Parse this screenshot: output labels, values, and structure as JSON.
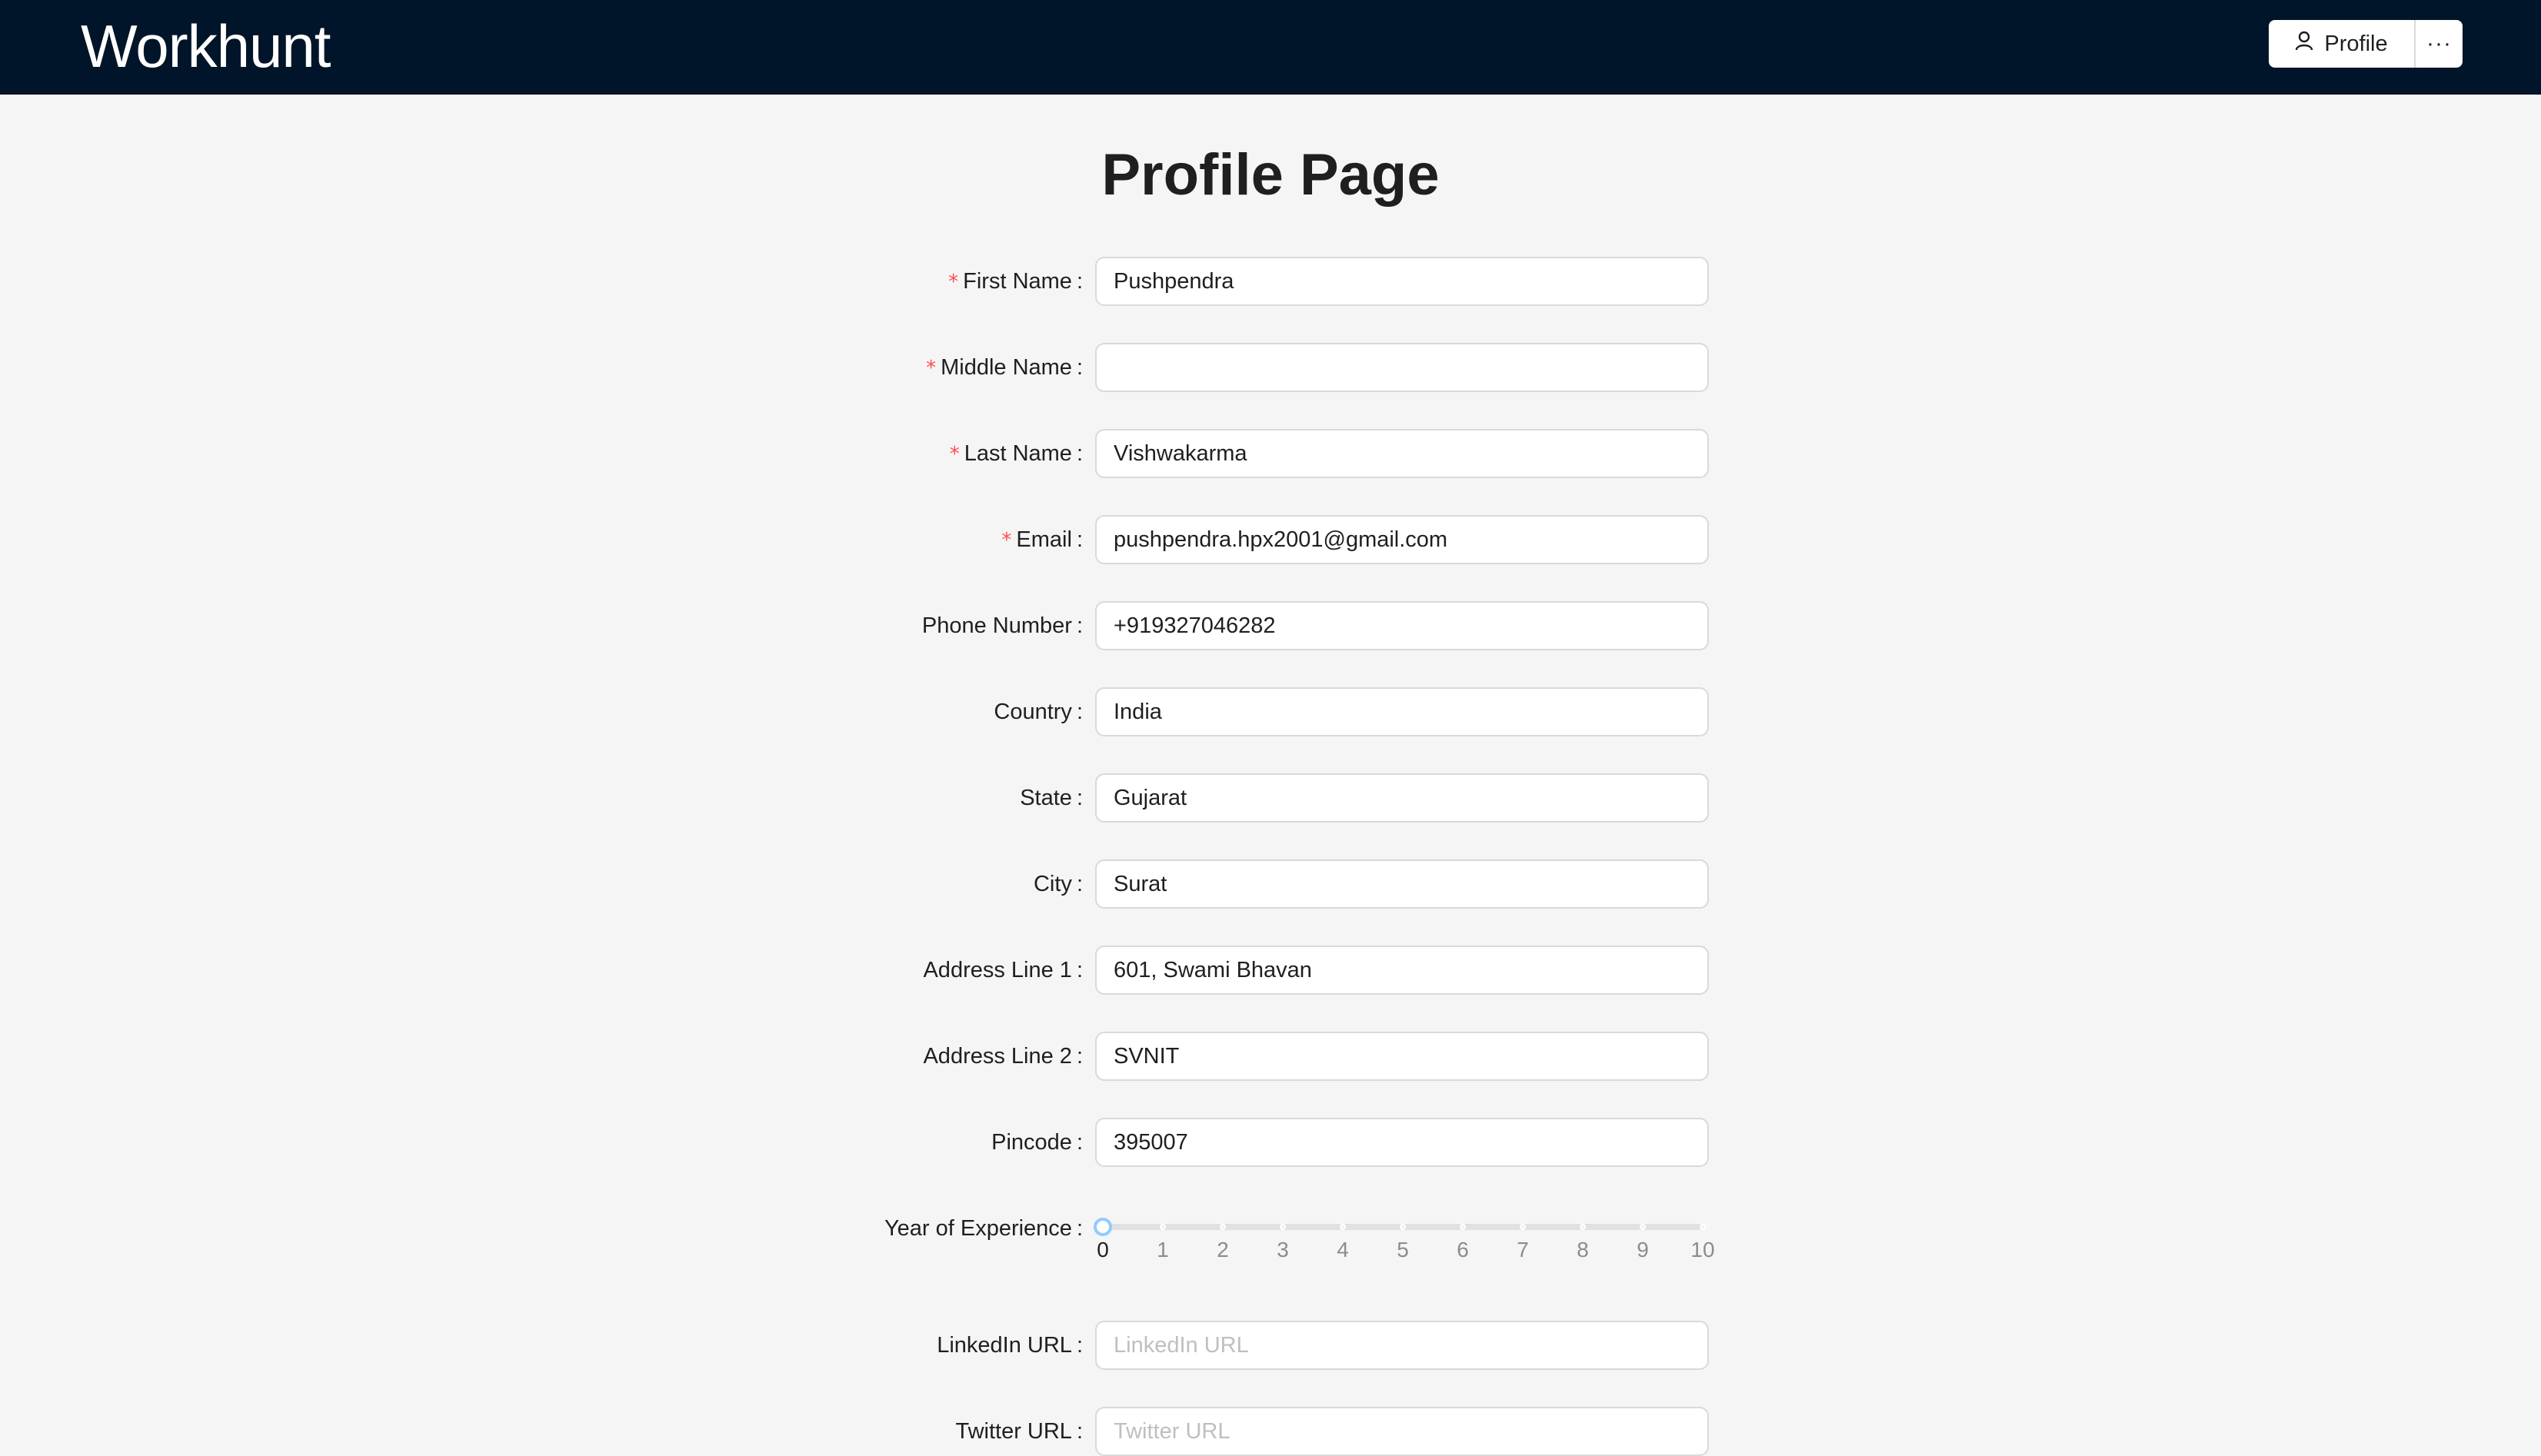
{
  "header": {
    "brand": "Workhunt",
    "profile_label": "Profile",
    "profile_icon": "user-icon",
    "more_label": "···",
    "background_color": "#001529"
  },
  "page": {
    "title": "Profile Page"
  },
  "form": {
    "required_mark": "*",
    "colon": ":",
    "fields": [
      {
        "label": "First Name",
        "value": "Pushpendra",
        "placeholder": "",
        "required": true
      },
      {
        "label": "Middle Name",
        "value": "",
        "placeholder": "",
        "required": true
      },
      {
        "label": "Last Name",
        "value": "Vishwakarma",
        "placeholder": "",
        "required": true
      },
      {
        "label": "Email",
        "value": "pushpendra.hpx2001@gmail.com",
        "placeholder": "",
        "required": true
      },
      {
        "label": "Phone Number",
        "value": "+919327046282",
        "placeholder": "",
        "required": false
      },
      {
        "label": "Country",
        "value": "India",
        "placeholder": "",
        "required": false
      },
      {
        "label": "State",
        "value": "Gujarat",
        "placeholder": "",
        "required": false
      },
      {
        "label": "City",
        "value": "Surat",
        "placeholder": "",
        "required": false
      },
      {
        "label": "Address Line 1",
        "value": "601, Swami Bhavan",
        "placeholder": "",
        "required": false
      },
      {
        "label": "Address Line 2",
        "value": "SVNIT",
        "placeholder": "",
        "required": false
      },
      {
        "label": "Pincode",
        "value": "395007",
        "placeholder": "",
        "required": false
      }
    ],
    "experience": {
      "label": "Year of Experience",
      "value": 0,
      "min": 0,
      "max": 10,
      "marks": [
        "0",
        "1",
        "2",
        "3",
        "4",
        "5",
        "6",
        "7",
        "8",
        "9",
        "10"
      ]
    },
    "social": [
      {
        "label": "LinkedIn URL",
        "value": "",
        "placeholder": "LinkedIn URL"
      },
      {
        "label": "Twitter URL",
        "value": "",
        "placeholder": "Twitter URL"
      }
    ]
  }
}
